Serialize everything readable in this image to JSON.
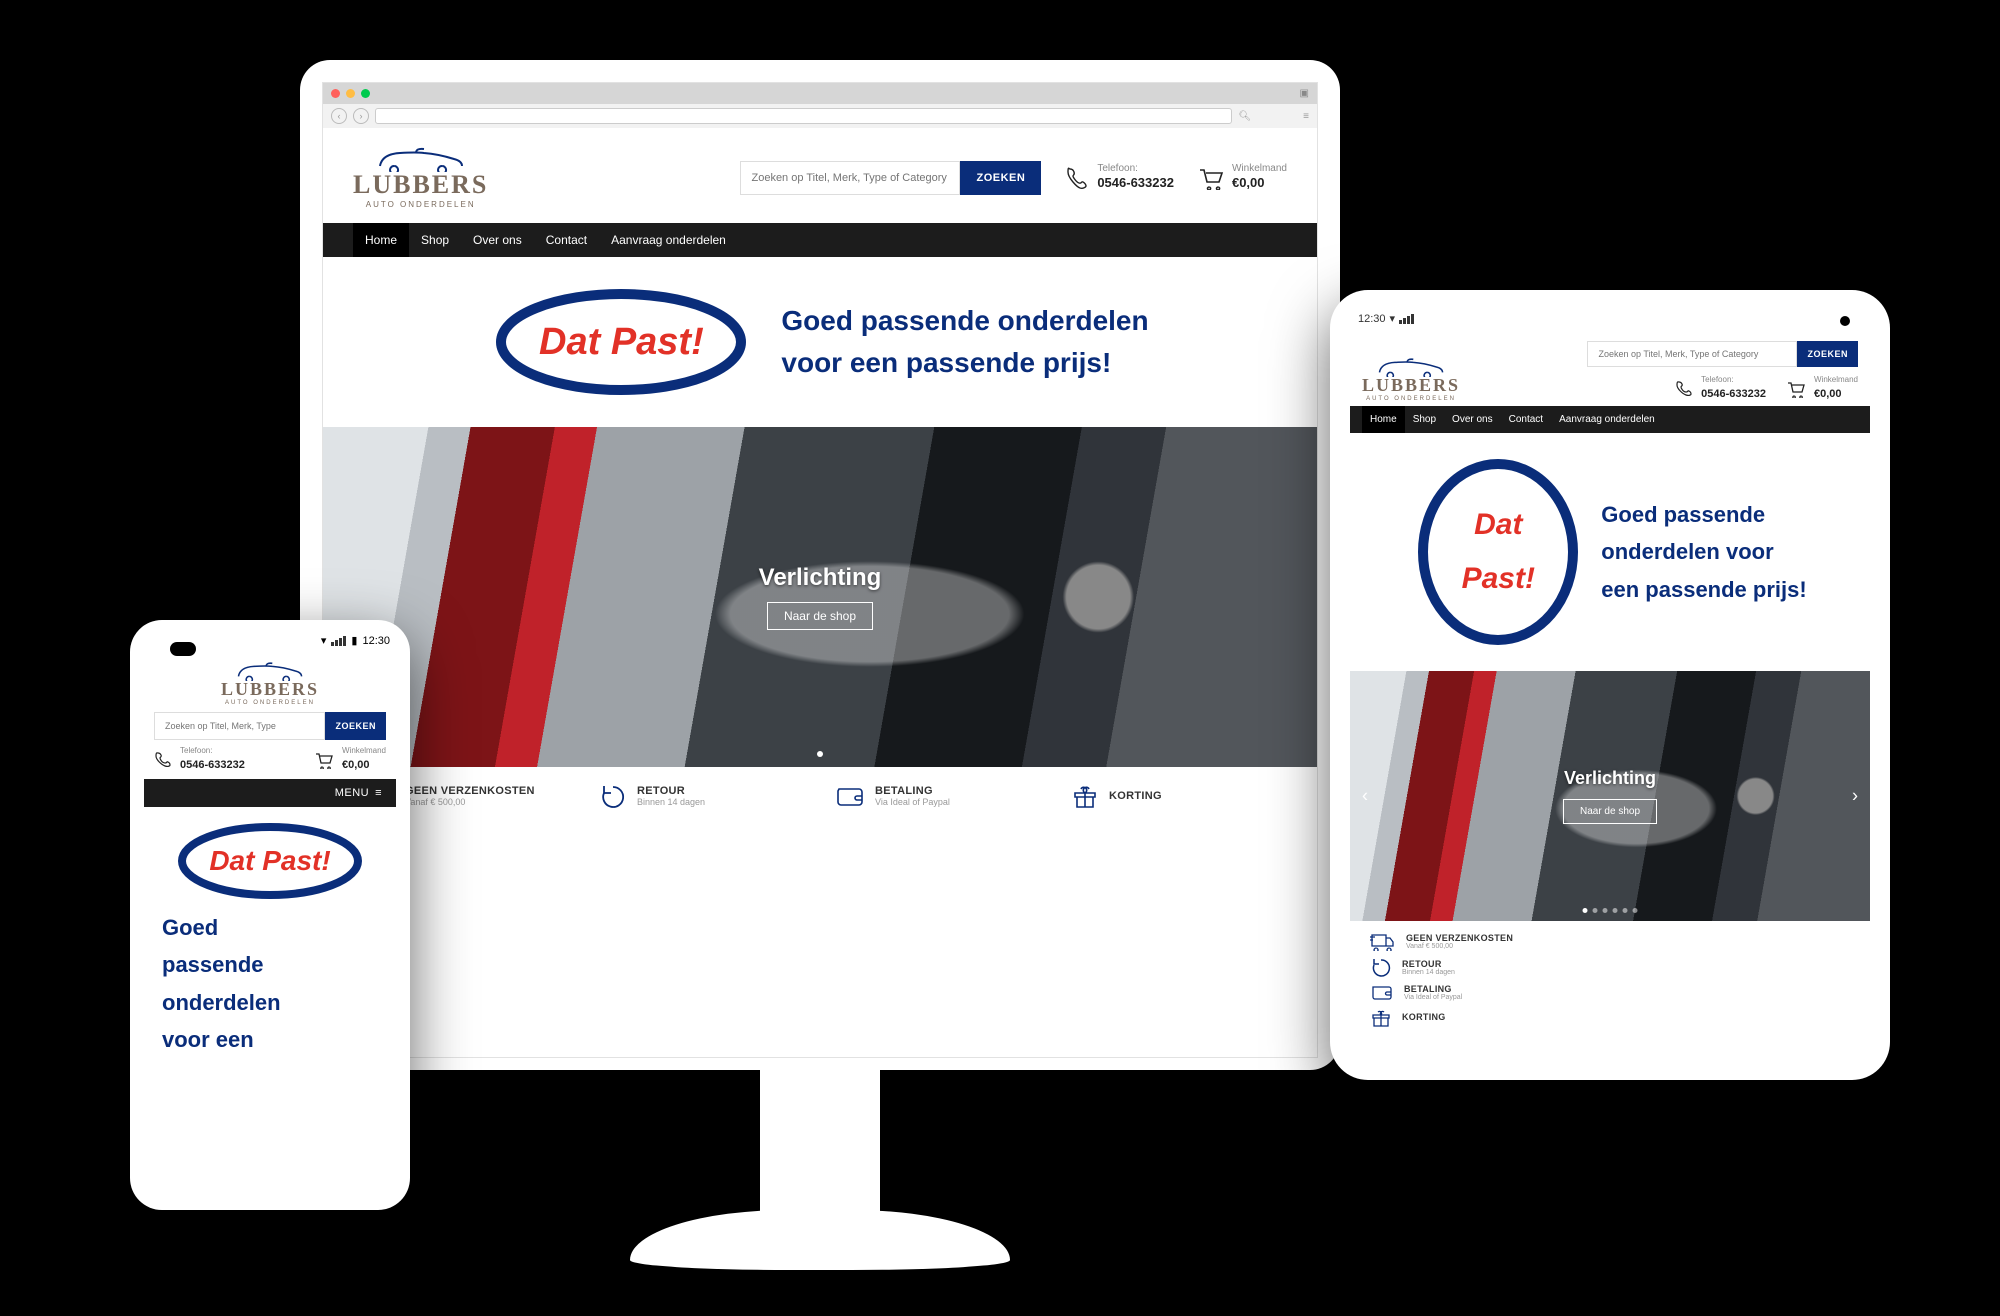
{
  "brand": {
    "name": "LUBBERS",
    "tagline": "AUTO ONDERDELEN"
  },
  "search": {
    "placeholder": "Zoeken op Titel, Merk, Type of Category",
    "placeholder_short": "Zoeken op Titel, Merk, Type",
    "button": "ZOEKEN"
  },
  "phone_info": {
    "label": "Telefoon:",
    "number": "0546-633232"
  },
  "cart": {
    "label": "Winkelmand",
    "amount": "€0,00"
  },
  "nav": {
    "home": "Home",
    "shop": "Shop",
    "about": "Over ons",
    "contact": "Contact",
    "request": "Aanvraag onderdelen"
  },
  "hero": {
    "badge_line1": "Dat",
    "badge_line2": "Past!",
    "badge_full": "Dat Past!",
    "slogan_l1": "Goed passende onderdelen",
    "slogan_l2": "voor een passende prijs!",
    "slogan_tablet_l1": "Goed passende",
    "slogan_tablet_l2": "onderdelen voor",
    "slogan_tablet_l3": "een passende prijs!",
    "slogan_phone_l1": "Goed",
    "slogan_phone_l2": "passende",
    "slogan_phone_l3": "onderdelen",
    "slogan_phone_l4": "voor een"
  },
  "carousel": {
    "title": "Verlichting",
    "button": "Naar de shop"
  },
  "features": {
    "ship": {
      "title": "GEEN VERZENKOSTEN",
      "sub": "Vanaf € 500,00"
    },
    "return": {
      "title": "RETOUR",
      "sub": "Binnen 14 dagen"
    },
    "pay": {
      "title": "BETALING",
      "sub": "Via Ideal of Paypal",
      "sub_short": "Via Ideal of Paypal"
    },
    "gift": {
      "title": "KORTING",
      "sub": ""
    }
  },
  "mobile_menu": {
    "label": "MENU"
  },
  "status": {
    "time": "12:30"
  },
  "icons": {
    "phone": "phone-icon",
    "cart": "cart-icon",
    "shipping": "shipping-icon",
    "return": "return-icon",
    "wallet": "wallet-icon",
    "gift": "gift-icon",
    "hamburger": "hamburger-icon",
    "chevron_left": "chevron-left-icon",
    "chevron_right": "chevron-right-icon"
  }
}
